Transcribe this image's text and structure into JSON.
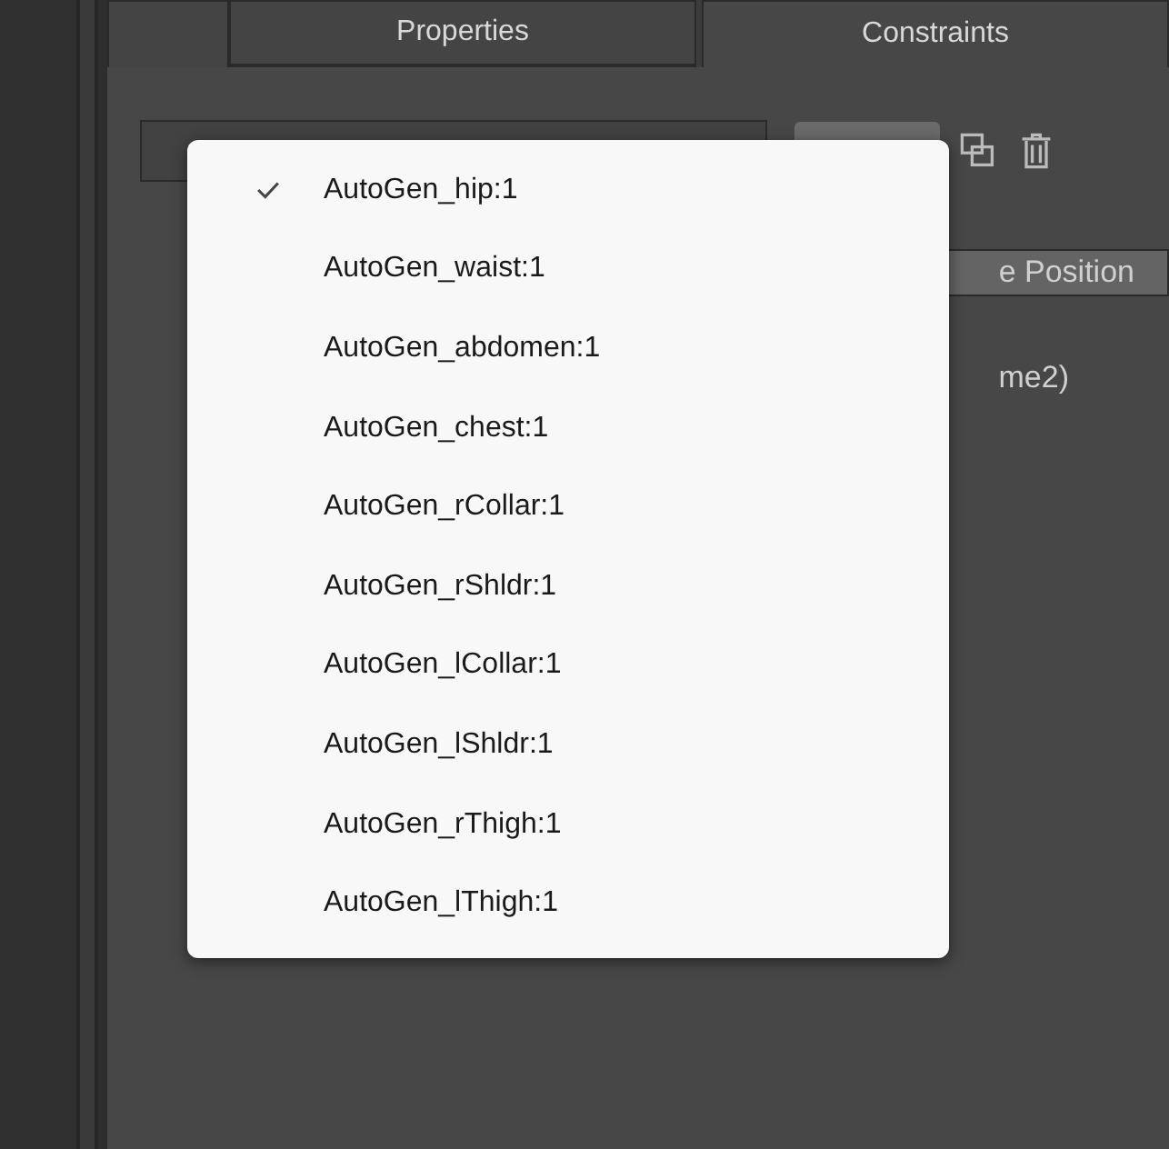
{
  "tabs": [
    {
      "label": "Properties",
      "selected": false
    },
    {
      "label": "Constraints",
      "selected": true
    }
  ],
  "panel": {
    "button_label": "e Position",
    "text": "me2)"
  },
  "menu": {
    "items": [
      {
        "label": "AutoGen_hip:1",
        "checked": true
      },
      {
        "label": "AutoGen_waist:1",
        "checked": false
      },
      {
        "label": "AutoGen_abdomen:1",
        "checked": false
      },
      {
        "label": "AutoGen_chest:1",
        "checked": false
      },
      {
        "label": "AutoGen_rCollar:1",
        "checked": false
      },
      {
        "label": "AutoGen_rShldr:1",
        "checked": false
      },
      {
        "label": "AutoGen_lCollar:1",
        "checked": false
      },
      {
        "label": "AutoGen_lShldr:1",
        "checked": false
      },
      {
        "label": "AutoGen_rThigh:1",
        "checked": false
      },
      {
        "label": "AutoGen_lThigh:1",
        "checked": false
      }
    ]
  }
}
